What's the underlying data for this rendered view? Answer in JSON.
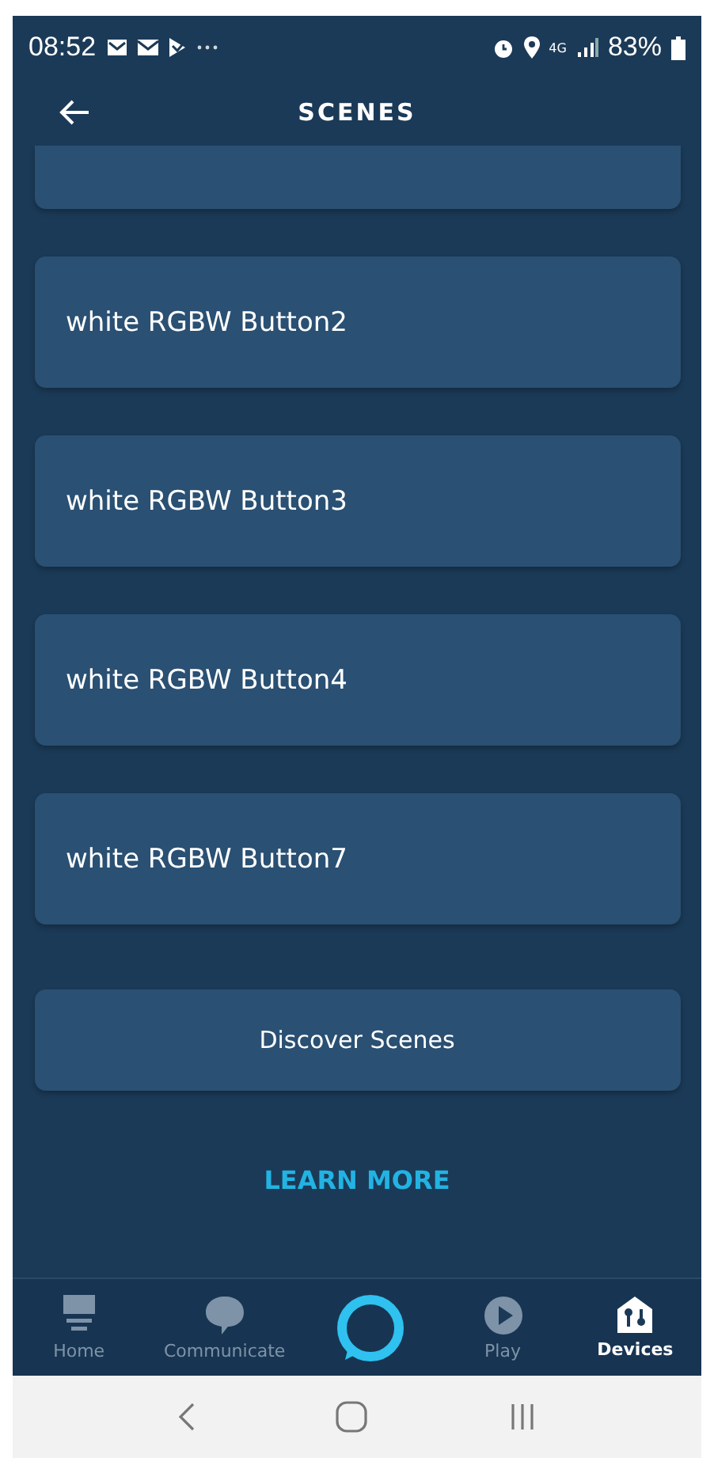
{
  "status_bar": {
    "time": "08:52",
    "network": "4G",
    "battery": "83%"
  },
  "header": {
    "title": "SCENES"
  },
  "scenes": [
    {
      "partial": true
    },
    {
      "label": "white RGBW Button2",
      "partial": false
    },
    {
      "label": "white RGBW Button3",
      "partial": false
    },
    {
      "label": "white RGBW Button4",
      "partial": false
    },
    {
      "label": "white RGBW Button7",
      "partial": false
    }
  ],
  "discover_button": "Discover Scenes",
  "learn_more": "LEARN MORE",
  "tab_bar": [
    {
      "kind": "home",
      "label": "Home",
      "selected": false
    },
    {
      "kind": "communicate",
      "label": "Communicate",
      "selected": false
    },
    {
      "kind": "alexa"
    },
    {
      "kind": "play",
      "label": "Play",
      "selected": false
    },
    {
      "kind": "devices",
      "label": "Devices",
      "selected": true
    }
  ]
}
